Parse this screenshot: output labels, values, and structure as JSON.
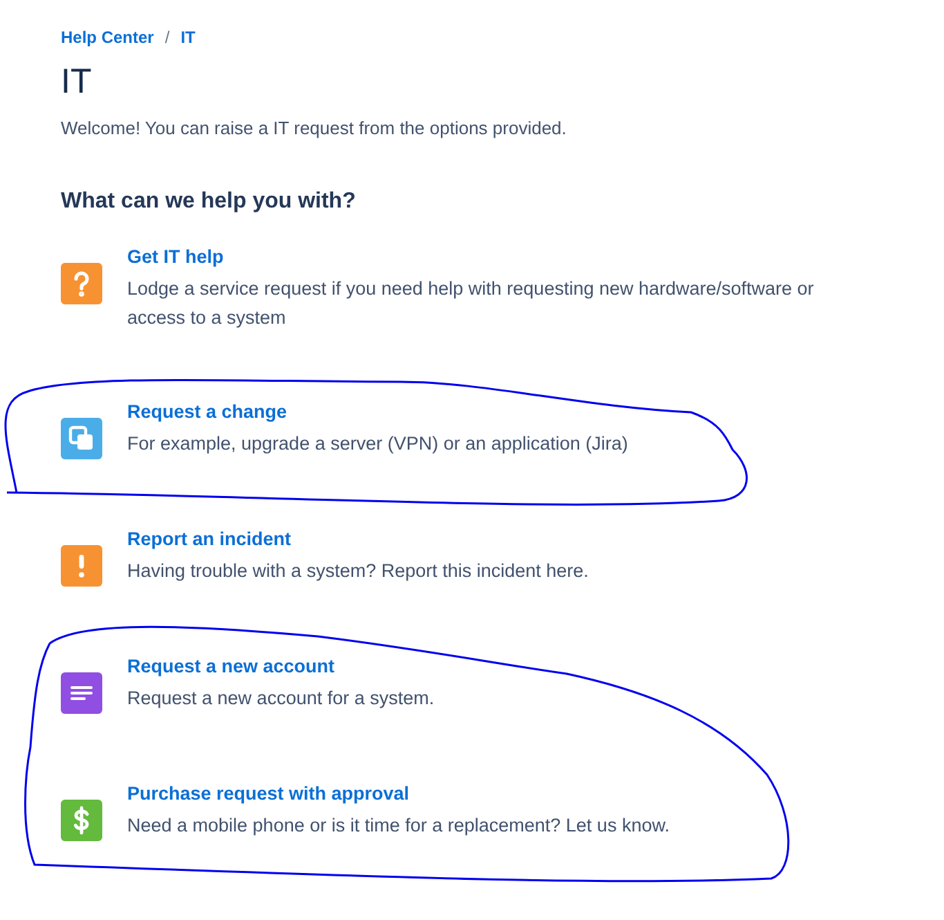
{
  "breadcrumb": [
    "Help Center",
    "IT"
  ],
  "breadcrumb_separator": "/",
  "title": "IT",
  "welcome": "Welcome! You can raise a IT request from the options provided.",
  "section_heading": "What can we help you with?",
  "request_types": [
    {
      "title": "Get IT help",
      "description": "Lodge a service request if you need help with requesting new hardware/software or access to a system",
      "kind": "question",
      "color": "#f79232"
    },
    {
      "title": "Request a change",
      "description": "For example, upgrade a server (VPN) or an application (Jira)",
      "kind": "change",
      "color": "#4bade8"
    },
    {
      "title": "Report an incident",
      "description": "Having trouble with a system? Report this incident here.",
      "kind": "alert",
      "color": "#f79232"
    },
    {
      "title": "Request a new account",
      "description": "Request a new account for a system.",
      "kind": "form",
      "color": "#904ee2"
    },
    {
      "title": "Purchase request with approval",
      "description": "Need a mobile phone or is it time for a replacement? Let us know.",
      "kind": "dollar",
      "color": "#63ba3c"
    }
  ]
}
